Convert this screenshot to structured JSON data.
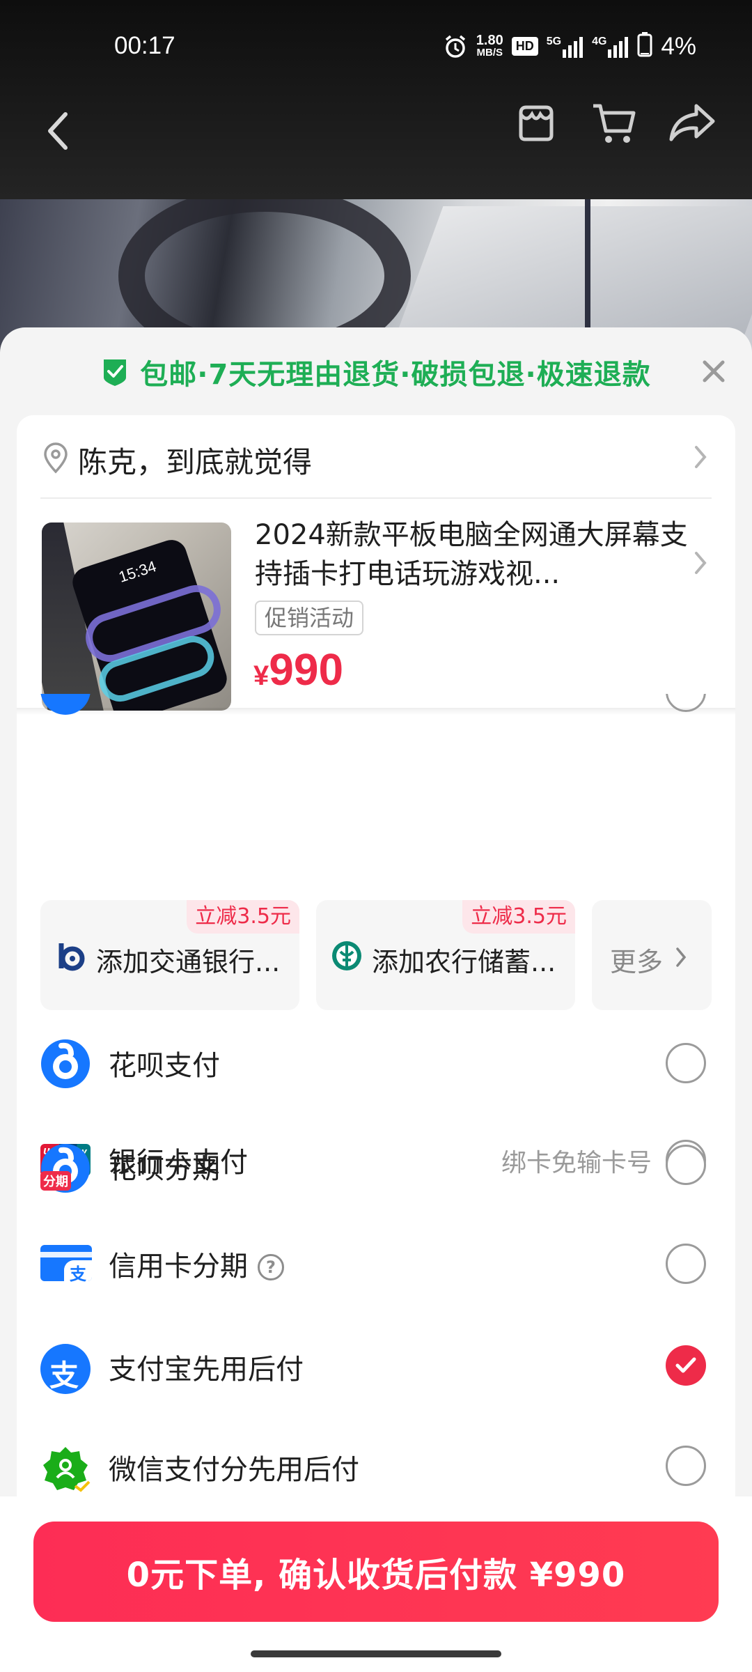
{
  "status_bar": {
    "time": "00:17",
    "net_speed_value": "1.80",
    "net_speed_unit": "MB/S",
    "hd_label": "HD",
    "signal1_label": "5G",
    "signal2_label": "4G",
    "battery": "4%"
  },
  "guarantee": {
    "text": "包邮·7天无理由退货·破损包退·极速退款",
    "color": "#1eae55"
  },
  "address": {
    "text": "陈克，到底就觉得"
  },
  "product": {
    "title": "2024新款平板电脑全网通大屏幕支持插卡打电话玩游戏视...",
    "thumb_time": "15:34",
    "promo_tag": "促销活动",
    "currency": "¥",
    "price": "990"
  },
  "payments": {
    "bank_card": {
      "label": "银行卡支付",
      "hint": "绑卡免输卡号",
      "icon_text_top": "UnionPay",
      "icon_text_bottom": "银联"
    },
    "bank_chips": [
      {
        "badge": "立减3.5元",
        "label": "添加交通银行..."
      },
      {
        "badge": "立减3.5元",
        "label": "添加农行储蓄..."
      }
    ],
    "more_label": "更多",
    "huabei": {
      "label": "花呗支付"
    },
    "huabei_installment": {
      "label": "花呗分期",
      "badge": "分期"
    },
    "credit_installment": {
      "label": "信用卡分期",
      "help": "?",
      "icon_char": "支"
    },
    "alipay_later": {
      "label": "支付宝先用后付",
      "icon_char": "支",
      "selected": true
    },
    "wechat_later": {
      "label": "微信支付分先用后付"
    }
  },
  "cta": {
    "label": "0元下单, 确认收货后付款 ¥990",
    "color": "#fd2d55"
  },
  "colors": {
    "accent_red": "#ee2b49",
    "alipay_blue": "#1677ff",
    "wechat_green": "#1aad19"
  }
}
